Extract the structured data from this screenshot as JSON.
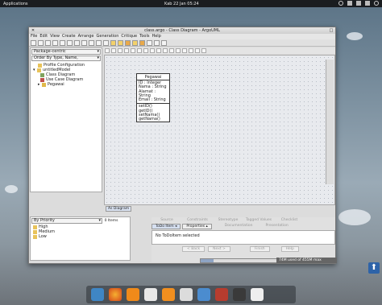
{
  "topbar": {
    "apps_label": "Applications",
    "clock": "Kab 22 Jan 05:24"
  },
  "window": {
    "title": "class.argo - Class Diagram - ArgoUML"
  },
  "menu": [
    "File",
    "Edit",
    "View",
    "Create",
    "Arrange",
    "Generation",
    "Critique",
    "Tools",
    "Help"
  ],
  "left_panel": {
    "perspective": "Package-centric",
    "order": "Order By Type, Name,",
    "tree": [
      {
        "label": "Profile Configuration",
        "level": 1
      },
      {
        "label": "untitledModel",
        "level": 0
      },
      {
        "label": "Class Diagram",
        "level": 1
      },
      {
        "label": "Use Case Diagram",
        "level": 1
      },
      {
        "label": "Pegawai",
        "level": 1
      }
    ]
  },
  "class_box": {
    "name": "Pegawai",
    "attributes": [
      "ID : Integer",
      "Nama : String",
      "Alamat : String",
      "Email : String"
    ],
    "operations": [
      "setID()",
      "getID()",
      "setNama()",
      "getNama()"
    ]
  },
  "diagram_tab": "As Diagram",
  "bottom_left": {
    "priority": "By Priority",
    "count": "0 Items",
    "items": [
      "High",
      "Medium",
      "Low"
    ]
  },
  "bottom_right": {
    "gray_tabs": [
      "Source",
      "Constraints",
      "Stereotype",
      "Tagged Values",
      "Checklist"
    ],
    "gray_tabs2": [
      "Properties",
      "Documentation",
      "Presentation"
    ],
    "todo_tabs": [
      "ToDo Item",
      "Properties"
    ],
    "message": "No ToDoItem selected",
    "buttons": [
      "< Back",
      "Next >",
      "Finish",
      "Help"
    ]
  },
  "memory": {
    "label": "74M used of 455M max",
    "fraction": 0.16
  },
  "colors": {
    "topbar": "#1a1d20",
    "accent": "#2e63a8"
  },
  "dock": [
    "files",
    "firefox",
    "vlc",
    "photos",
    "audio",
    "app",
    "download",
    "presentation",
    "term",
    "chess"
  ]
}
